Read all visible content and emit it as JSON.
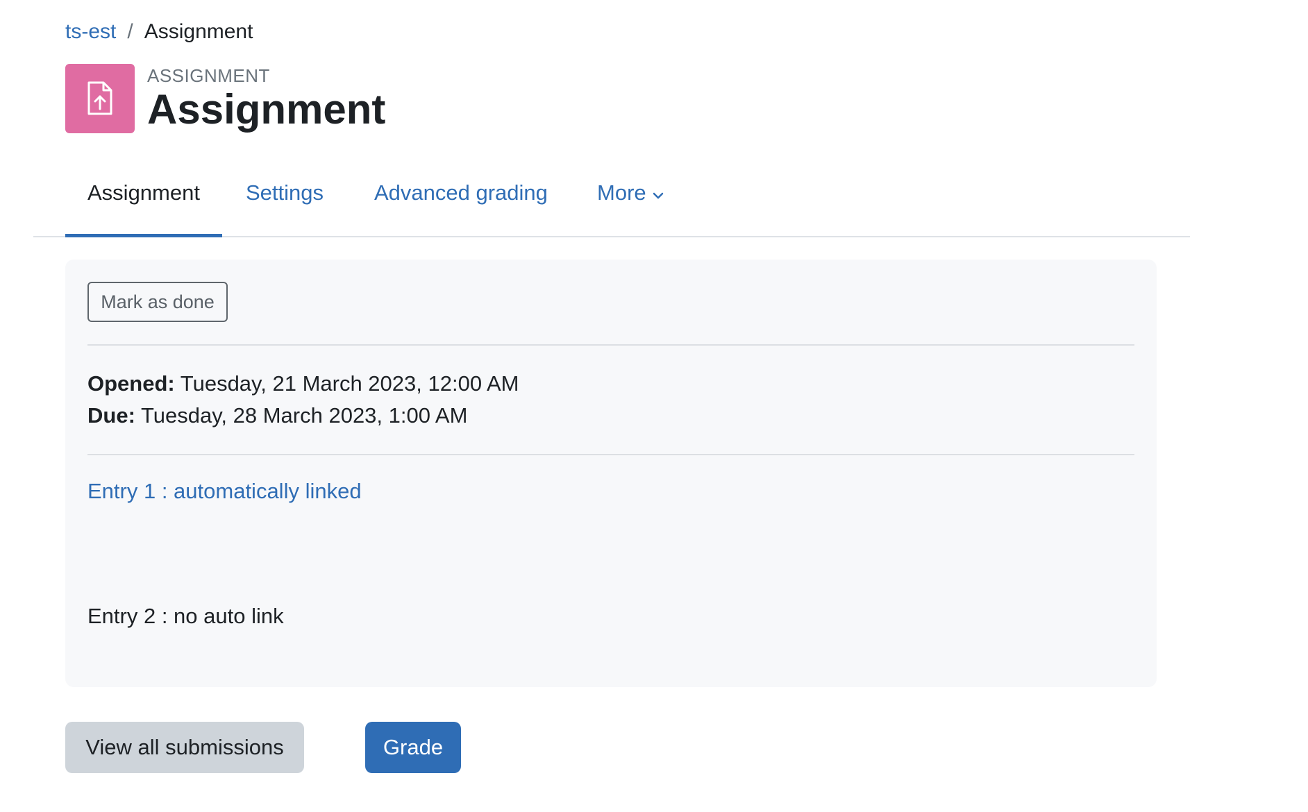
{
  "breadcrumb": {
    "course": "ts-est",
    "separator": "/",
    "current": "Assignment"
  },
  "header": {
    "icon": "file-upload-icon",
    "icon_color": "#e06ca2",
    "pre_title": "ASSIGNMENT",
    "title": "Assignment"
  },
  "tabs": [
    {
      "label": "Assignment",
      "active": true
    },
    {
      "label": "Settings",
      "active": false
    },
    {
      "label": "Advanced grading",
      "active": false
    },
    {
      "label": "More",
      "active": false,
      "icon": "chevron-down-icon"
    }
  ],
  "card": {
    "mark_done_label": "Mark as done",
    "opened_label": "Opened:",
    "opened_value": "Tuesday, 21 March 2023, 12:00 AM",
    "due_label": "Due:",
    "due_value": "Tuesday, 28 March 2023, 1:00 AM",
    "entry1": "Entry 1 : automatically linked",
    "entry2": "Entry 2 : no auto link"
  },
  "actions": {
    "view_all_label": "View all submissions",
    "grade_label": "Grade"
  },
  "colors": {
    "link": "#2f6db5",
    "primary": "#2f6db5",
    "secondary": "#ced4da",
    "card_bg": "#f7f8fa"
  }
}
